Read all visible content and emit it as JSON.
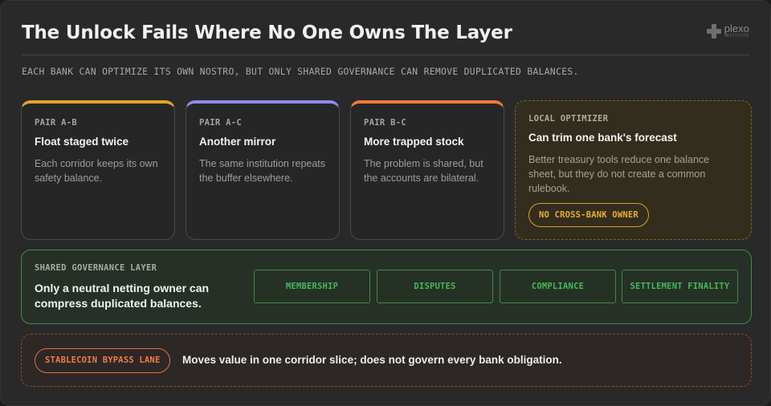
{
  "header": {
    "title": "The Unlock Fails Where No One Owns The Layer",
    "subtitle": "EACH BANK CAN OPTIMIZE ITS OWN NOSTRO, BUT ONLY SHARED GOVERNANCE CAN REMOVE DUPLICATED BALANCES.",
    "logo": {
      "name": "plexo",
      "sub": "INSTITUTE",
      "icon": "plus-cross-icon"
    }
  },
  "pairs": [
    {
      "tag": "PAIR A-B",
      "heading": "Float staged twice",
      "body": "Each corridor keeps its own safety balance.",
      "accent": "#e0a52a"
    },
    {
      "tag": "PAIR A-C",
      "heading": "Another mirror",
      "body": "The same institution repeats the buffer elsewhere.",
      "accent": "#8f8bf0"
    },
    {
      "tag": "PAIR B-C",
      "heading": "More trapped stock",
      "body": "The problem is shared, but the accounts are bilateral.",
      "accent": "#f07a3c"
    }
  ],
  "optimizer": {
    "tag": "LOCAL OPTIMIZER",
    "heading": "Can trim one bank's forecast",
    "body": "Better treasury tools reduce one balance sheet, but they do not create a common rulebook.",
    "badge": "NO CROSS-BANK OWNER"
  },
  "governance": {
    "tag": "SHARED GOVERNANCE LAYER",
    "heading": "Only a neutral netting owner can compress duplicated balances.",
    "chips": [
      "MEMBERSHIP",
      "DISPUTES",
      "COMPLIANCE",
      "SETTLEMENT FINALITY"
    ]
  },
  "bypass": {
    "badge": "STABLECOIN BYPASS LANE",
    "note": "Moves value in one corridor slice; does not govern every bank obligation."
  },
  "colors": {
    "background": "#292929",
    "yellow": "#e0a52a",
    "purple": "#8f8bf0",
    "orange": "#f07a3c",
    "green": "#43b85c"
  }
}
